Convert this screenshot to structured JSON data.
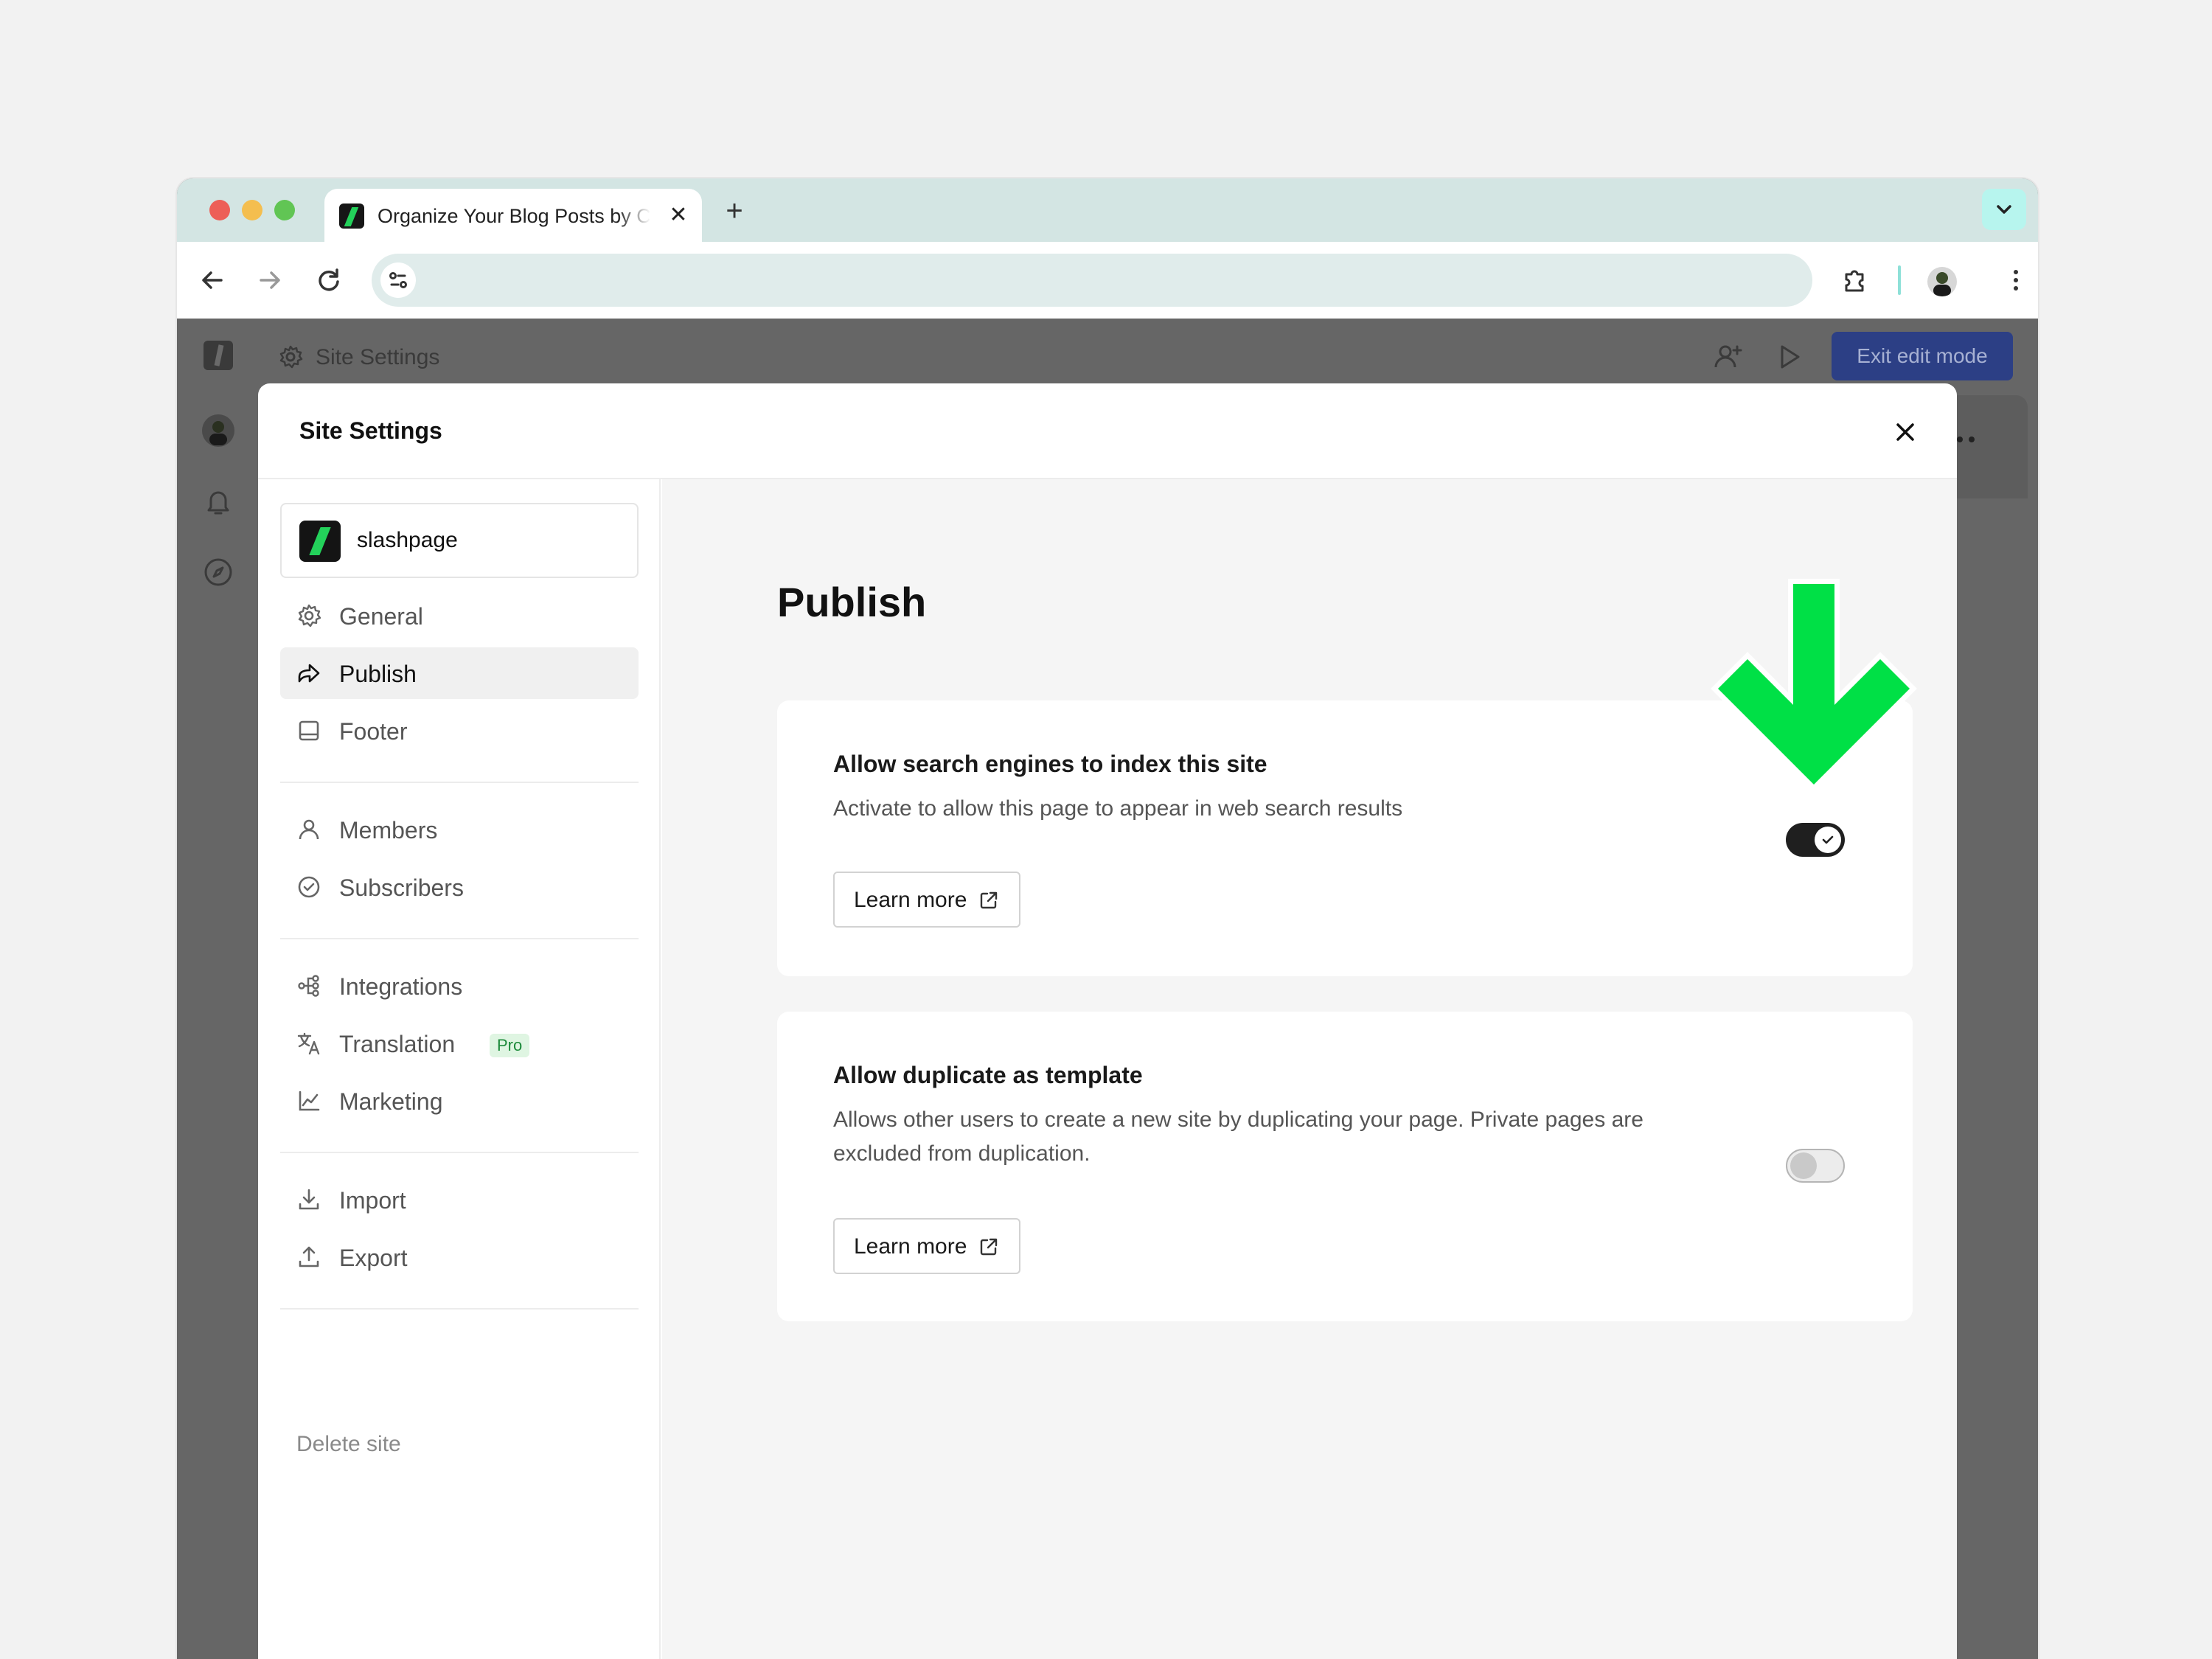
{
  "browser": {
    "tab_title": "Organize Your Blog Posts by Category",
    "tab_close_glyph": "✕",
    "new_tab_glyph": "+"
  },
  "app": {
    "header_title": "Site Settings",
    "exit_button": "Exit edit mode"
  },
  "modal": {
    "title": "Site Settings",
    "site_name": "slashpage",
    "nav": [
      {
        "label": "General",
        "icon": "gear-icon"
      },
      {
        "label": "Publish",
        "icon": "share-arrow-icon",
        "active": true
      },
      {
        "label": "Footer",
        "icon": "footer-layout-icon"
      },
      {
        "label": "Members",
        "icon": "person-icon"
      },
      {
        "label": "Subscribers",
        "icon": "check-circle-icon"
      },
      {
        "label": "Integrations",
        "icon": "integrations-icon"
      },
      {
        "label": "Translation",
        "icon": "translate-icon",
        "badge": "Pro"
      },
      {
        "label": "Marketing",
        "icon": "chart-line-icon"
      },
      {
        "label": "Import",
        "icon": "download-icon"
      },
      {
        "label": "Export",
        "icon": "upload-icon"
      }
    ],
    "delete_site": "Delete site"
  },
  "content": {
    "heading": "Publish",
    "settings": [
      {
        "title": "Allow search engines to index this site",
        "description": "Activate to allow this page to appear in web search results",
        "learn_more": "Learn more",
        "enabled": true
      },
      {
        "title": "Allow duplicate as template",
        "description": "Allows other users to create a new site by duplicating your page. Private pages are excluded from duplication.",
        "learn_more": "Learn more",
        "enabled": false
      }
    ]
  },
  "colors": {
    "accent_arrow": "#00e046",
    "exit_button_bg": "#2c3f85",
    "toggle_on": "#1f1f1f",
    "logo_green": "#23d15a"
  }
}
